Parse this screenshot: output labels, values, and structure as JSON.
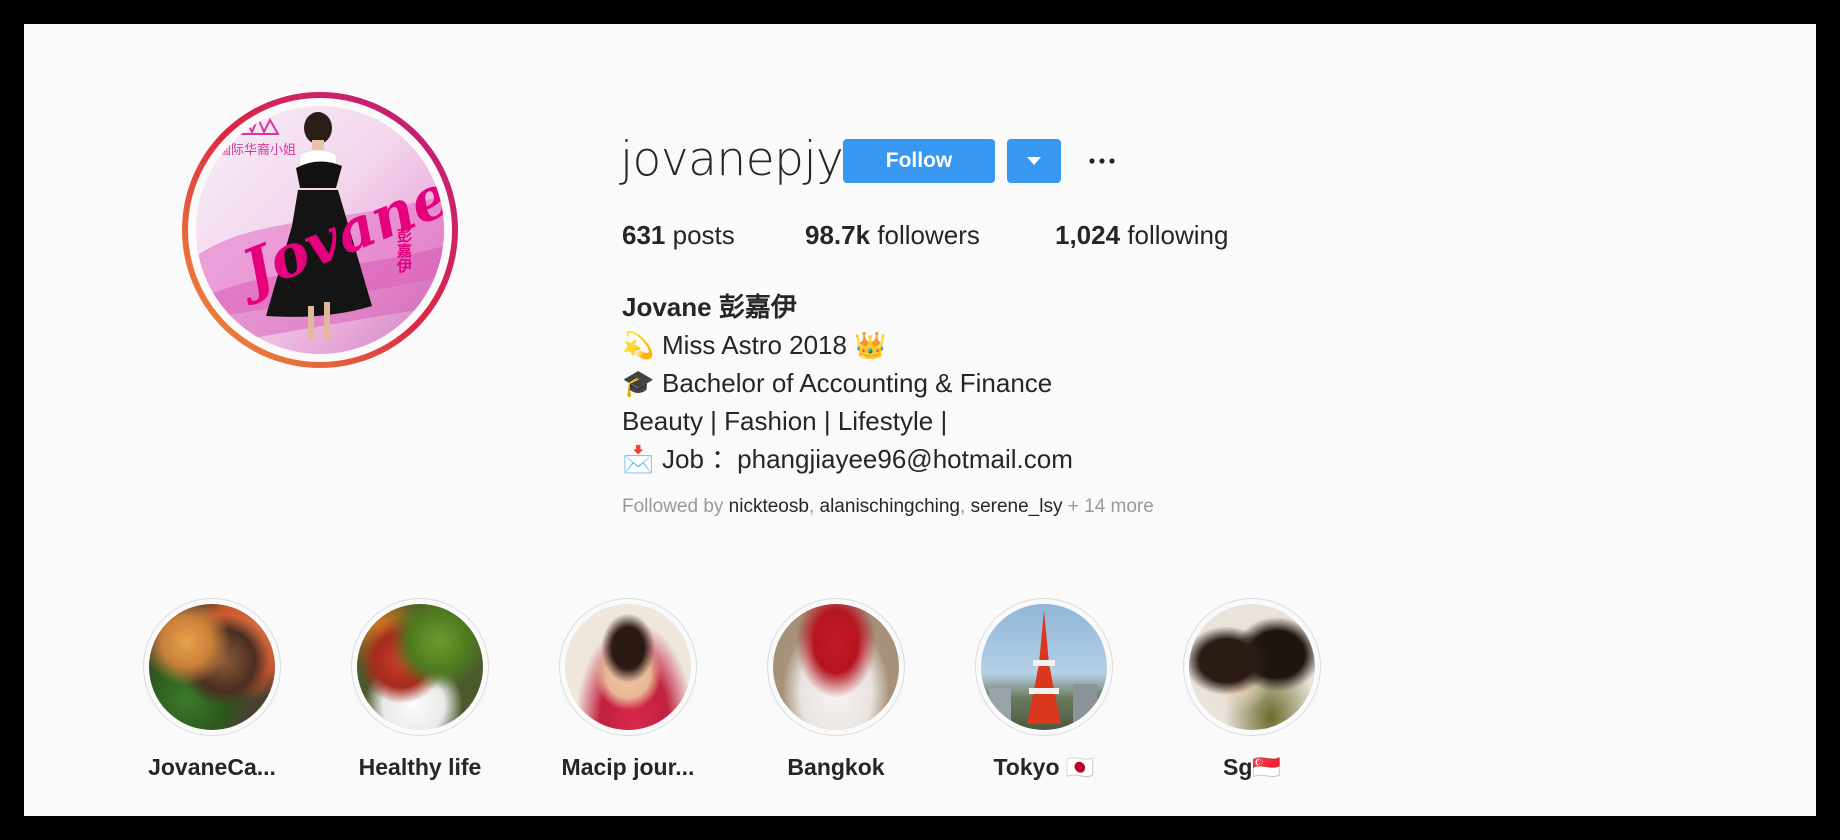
{
  "profile": {
    "username": "jovanepjy",
    "follow_label": "Follow",
    "more_icon": "ellipsis-icon",
    "dropdown_icon": "caret-down-icon",
    "accent": "#3897f0",
    "avatar_text": {
      "script": "Jovane",
      "chinese": "彭嘉伊",
      "logo_title": "国际华裔小姐"
    }
  },
  "stats": {
    "posts_count": "631",
    "posts_label": "posts",
    "followers_count": "98.7k",
    "followers_label": "followers",
    "following_count": "1,024",
    "following_label": "following"
  },
  "bio": {
    "name": "Jovane 彭嘉伊",
    "line1_emoji": "💫",
    "line1": "Miss Astro 2018 👑",
    "line2_emoji": "🎓",
    "line2": "Bachelor of Accounting & Finance",
    "line3": "Beauty | Fashion | Lifestyle |",
    "line4_emoji": "📩",
    "line4": "Job ：phangjiayee96@hotmail.com"
  },
  "followed_by": {
    "prefix": "Followed by",
    "users": [
      "nickteosb",
      "alanischingching",
      "serene_lsy"
    ],
    "more": "+ 14 more"
  },
  "highlights": [
    {
      "label": "JovaneCa..."
    },
    {
      "label": "Healthy life"
    },
    {
      "label": "Macip jour..."
    },
    {
      "label": "Bangkok"
    },
    {
      "label": "Tokyo 🇯🇵"
    },
    {
      "label": "Sg🇸🇬"
    }
  ]
}
